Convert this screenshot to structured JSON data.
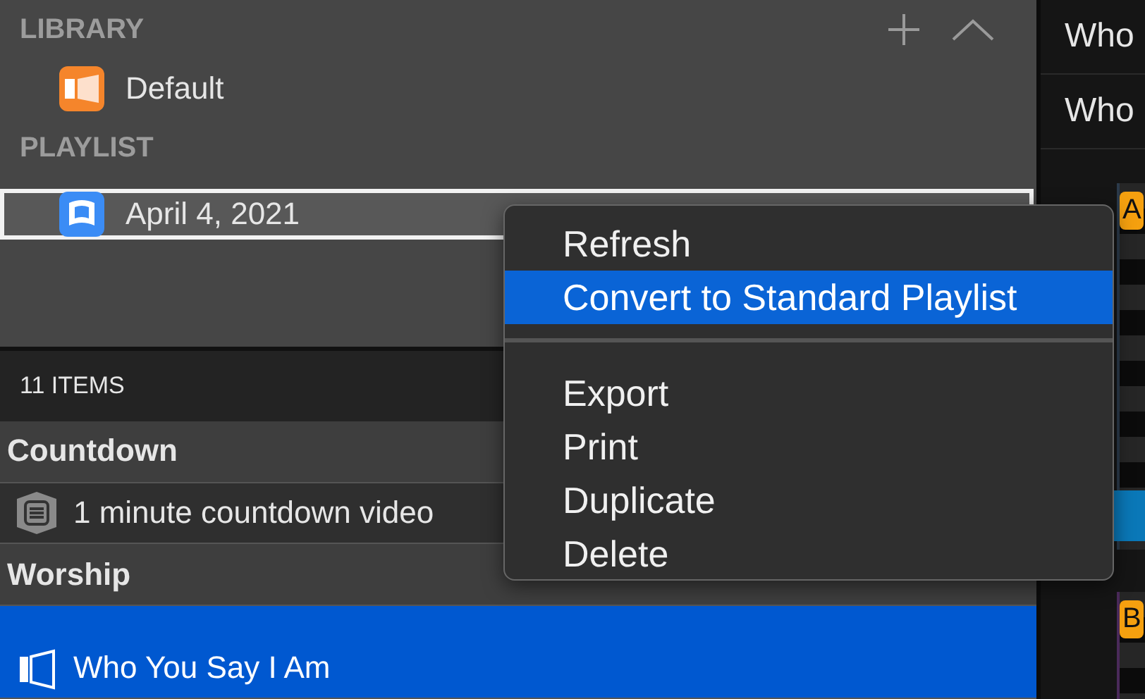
{
  "library": {
    "title": "LIBRARY",
    "items": [
      {
        "label": "Default",
        "kind": "library"
      }
    ]
  },
  "playlist": {
    "title": "PLAYLIST",
    "items": [
      {
        "label": "April 4, 2021",
        "kind": "playlist",
        "selected": true
      }
    ]
  },
  "items_header": "11 ITEMS",
  "groups": [
    {
      "title": "Countdown",
      "items": [
        {
          "label": "1 minute countdown video",
          "kind": "media",
          "selected": false
        }
      ]
    },
    {
      "title": "Worship",
      "items": [
        {
          "label": "Who You Say I Am",
          "kind": "song",
          "selected": true
        }
      ]
    }
  ],
  "right_panel": {
    "rows": [
      "Who",
      "Who"
    ],
    "badges": [
      "A",
      "B"
    ]
  },
  "context_menu": [
    {
      "kind": "item",
      "label": "Refresh",
      "selected": false
    },
    {
      "kind": "item",
      "label": "Convert to Standard Playlist",
      "selected": true
    },
    {
      "kind": "separator"
    },
    {
      "kind": "item",
      "label": "Export",
      "selected": false
    },
    {
      "kind": "item",
      "label": "Print",
      "selected": false
    },
    {
      "kind": "item",
      "label": "Duplicate",
      "selected": false
    },
    {
      "kind": "item",
      "label": "Delete",
      "selected": false
    }
  ]
}
